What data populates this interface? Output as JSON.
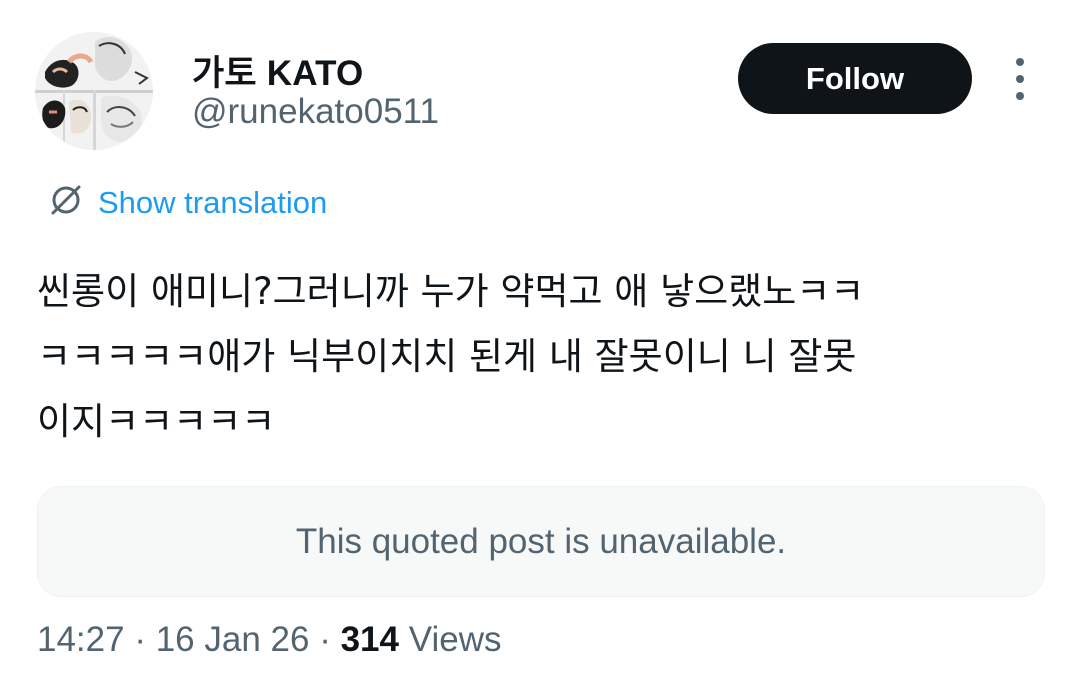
{
  "author": {
    "display_name": "가토 KATO",
    "handle": "@runekato0511"
  },
  "actions": {
    "follow_label": "Follow",
    "more_icon": "more-vertical-icon"
  },
  "translation": {
    "icon": "translate-icon",
    "label": "Show translation"
  },
  "tweet": {
    "lines": [
      "씬롱이 애미니?그러니까 누가 약먹고 애 낳으랬노ㅋㅋ",
      "ㅋㅋㅋㅋㅋ애가 닉부이치치 된게 내 잘못이니 니 잘못",
      "이지ㅋㅋㅋㅋㅋ"
    ]
  },
  "quote": {
    "text": "This quoted post is unavailable."
  },
  "meta": {
    "time": "14:27",
    "separator": "·",
    "date": "16 Jan 26",
    "views_count": "314",
    "views_label": "Views"
  },
  "colors": {
    "accent": "#1d9bf0",
    "text": "#0f1419",
    "secondary": "#536471",
    "quote_bg": "#f7f9f9"
  }
}
